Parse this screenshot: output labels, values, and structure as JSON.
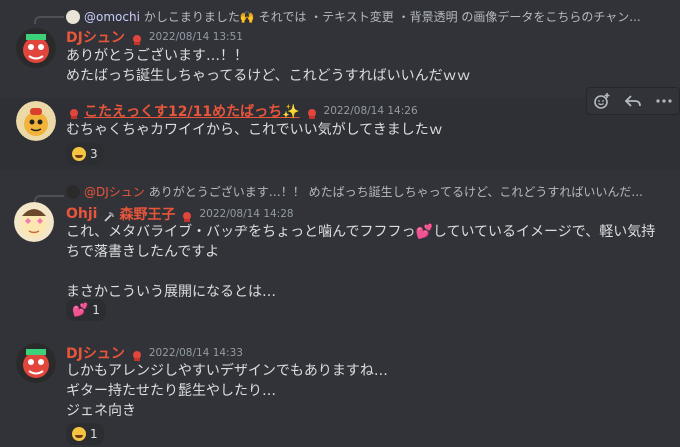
{
  "messages": [
    {
      "reply": {
        "author": "@omochi",
        "text": "かしこまりました🙌 それでは ・テキスト変更 ・背景透明 の画像データをこちらのチャン..."
      },
      "author": "DJシュン",
      "timestamp": "2022/08/14 13:51",
      "lines": [
        "ありがとうございます…！！",
        "めたばっち誕生しちゃってるけど、これどうすればいいんだｗｗ"
      ]
    },
    {
      "author": "こたえっくす12/11めたばっち✨",
      "timestamp": "2022/08/14 14:26",
      "lines": [
        "むちゃくちゃカワイイから、これでいい気がしてきましたｗ"
      ],
      "reaction": {
        "emoji": "rofl-emoji",
        "count": "3"
      }
    },
    {
      "reply": {
        "author": "@DJシュン",
        "text": "ありがとうございます…！！ めたばっち誕生しちゃってるけど、これどうすればいいんだ..."
      },
      "author": "Ohji",
      "author_suffix": "森野王子",
      "timestamp": "2022/08/14 14:28",
      "lines": [
        "これ、メタバライブ・バッヂをちょっと噛んでフフフっ💕していているイメージで、軽い気持",
        "ちで落書きしたんですよ",
        "",
        "まさかこういう展開になるとは…"
      ],
      "reaction": {
        "emoji": "heart-emoji",
        "count": "1"
      }
    },
    {
      "author": "DJシュン",
      "timestamp": "2022/08/14 14:33",
      "lines": [
        "しかもアレンジしやすいデザインでもありますね…",
        "ギター持たせたり髭生やしたり…",
        "ジェネ向き"
      ],
      "reaction": {
        "emoji": "rofl-emoji",
        "count": "1"
      }
    }
  ],
  "colors": {
    "background": "#313338",
    "dj_name": "#e8553a",
    "kotae_name": "#e8553a",
    "ohji_name": "#e8553a",
    "mention": "#c9cdfb",
    "text": "#dbdee1",
    "timestamp": "#949ba4"
  },
  "toolbar": {
    "icons": [
      "add-reaction-icon",
      "reply-icon",
      "more-options-icon"
    ]
  }
}
